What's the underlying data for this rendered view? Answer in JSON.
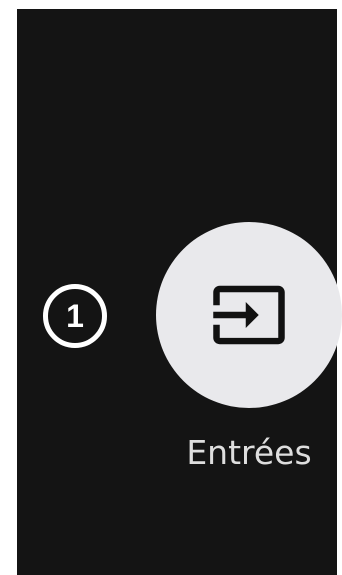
{
  "step": {
    "number": "1"
  },
  "tile": {
    "label": "Entrées",
    "icon": "input-icon"
  },
  "colors": {
    "screen_background": "#141414",
    "tile_background": "#e9e9ec",
    "icon": "#111111",
    "badge": "#ffffff",
    "label": "#dedede"
  }
}
